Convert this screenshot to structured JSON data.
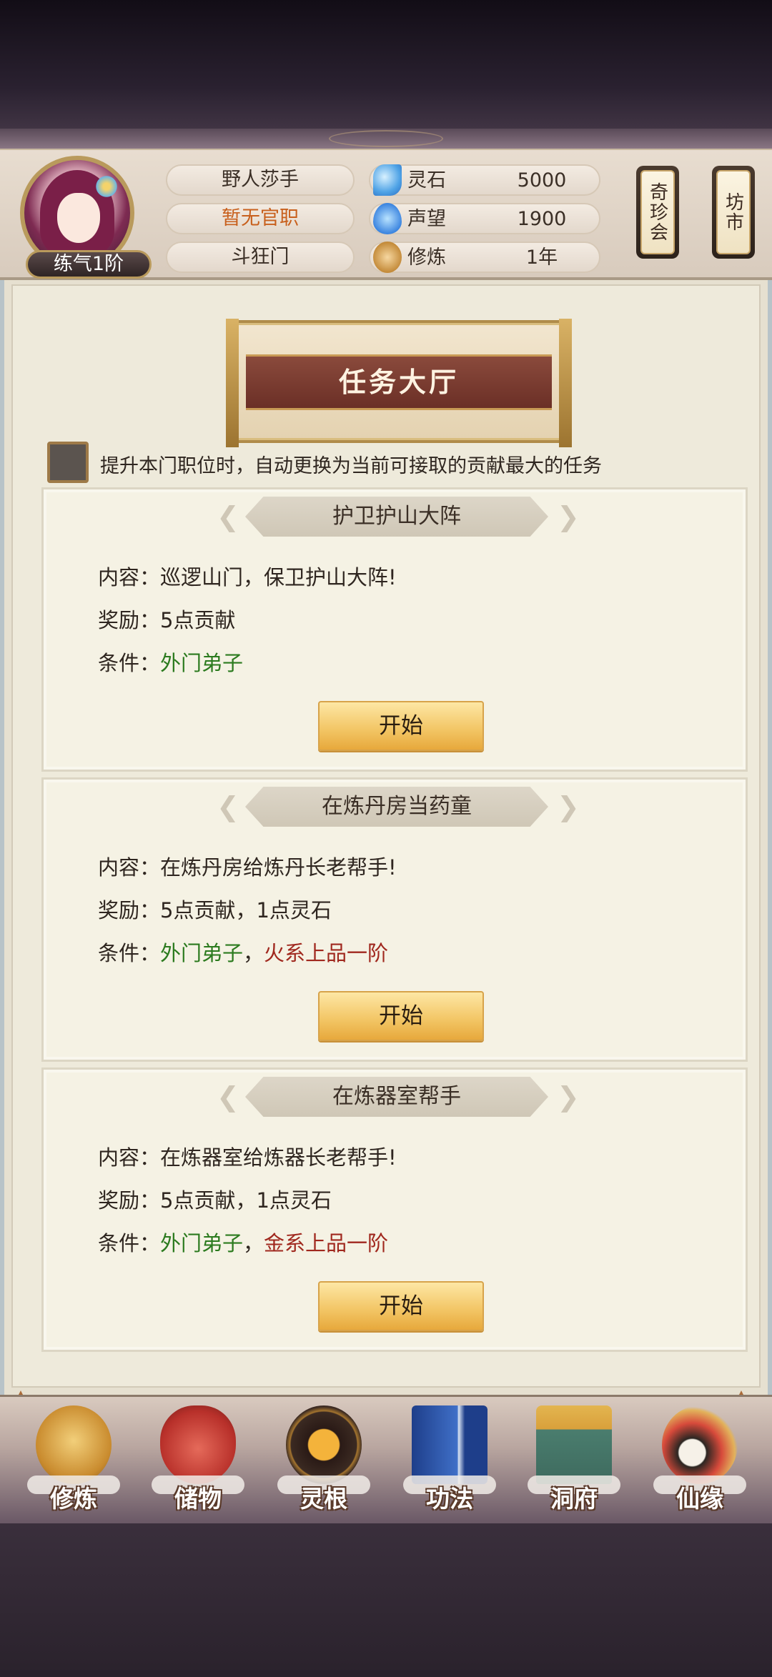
{
  "player": {
    "name": "野人莎手",
    "official_rank": "暂无官职",
    "sect": "斗狂门",
    "level": "练气1阶"
  },
  "resources": [
    {
      "icon": "spirit-stone-icon",
      "label": "灵石",
      "value": "5000"
    },
    {
      "icon": "reputation-icon",
      "label": "声望",
      "value": "1900"
    },
    {
      "icon": "cultivation-icon",
      "label": "修炼",
      "value": "1年"
    }
  ],
  "side_buttons": [
    {
      "label": "奇珍会"
    },
    {
      "label": "坊市"
    }
  ],
  "hall": {
    "title": "任务大厅",
    "auto_option": "提升本门职位时，自动更换为当前可接取的贡献最大的任务"
  },
  "tasks": [
    {
      "title": "护卫护山大阵",
      "content_label": "内容：",
      "content": "巡逻山门，保卫护山大阵!",
      "reward_label": "奖励：",
      "reward": "5点贡献",
      "condition_label": "条件：",
      "condition_green": "外门弟子",
      "condition_sep": "",
      "condition_red": "",
      "button": "开始"
    },
    {
      "title": "在炼丹房当药童",
      "content_label": "内容：",
      "content": "在炼丹房给炼丹长老帮手!",
      "reward_label": "奖励：",
      "reward": "5点贡献，1点灵石",
      "condition_label": "条件：",
      "condition_green": "外门弟子",
      "condition_sep": "，",
      "condition_red": "火系上品一阶",
      "button": "开始"
    },
    {
      "title": "在炼器室帮手",
      "content_label": "内容：",
      "content": "在炼器室给炼器长老帮手!",
      "reward_label": "奖励：",
      "reward": "5点贡献，1点灵石",
      "condition_label": "条件：",
      "condition_green": "外门弟子",
      "condition_sep": "，",
      "condition_red": "金系上品一阶",
      "button": "开始"
    }
  ],
  "nav": [
    {
      "label": "修炼",
      "icon": "cultivate-icon"
    },
    {
      "label": "储物",
      "icon": "storage-bag-icon"
    },
    {
      "label": "灵根",
      "icon": "spirit-root-icon"
    },
    {
      "label": "功法",
      "icon": "technique-book-icon"
    },
    {
      "label": "洞府",
      "icon": "cave-dwelling-icon"
    },
    {
      "label": "仙缘",
      "icon": "immortal-fate-icon"
    }
  ],
  "colors": {
    "accent_gold": "#e7a93c",
    "condition_green": "#2b7a1e",
    "condition_red": "#a0281e",
    "rank_orange": "#c8601d"
  }
}
